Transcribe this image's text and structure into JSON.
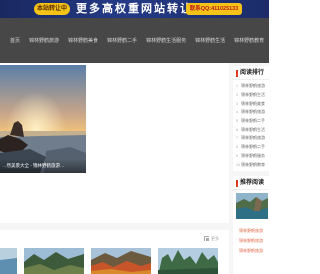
{
  "banner": {
    "badge": "本站转让中",
    "title": "更多高权重网站转让",
    "contact": "联系QQ:411025133"
  },
  "nav": {
    "items": [
      "首页",
      "锦林野鹤旅游",
      "锦林野鹤美食",
      "锦林野鹤二手",
      "锦林野鹤生活服务",
      "锦林野鹤生活",
      "锦林野鹤教育"
    ]
  },
  "hero": {
    "caption": "…然美景大全 - 锦林野鹤旅游…"
  },
  "sidebar": {
    "rank_title": "阅读排行",
    "rank_items": [
      {
        "num": "1",
        "text": "锦林野鹤旅游"
      },
      {
        "num": "2",
        "text": "锦林野鹤生活"
      },
      {
        "num": "3",
        "text": "锦林野鹤美食"
      },
      {
        "num": "4",
        "text": "锦林野鹤旅游"
      },
      {
        "num": "5",
        "text": "锦林野鹤二手"
      },
      {
        "num": "6",
        "text": "锦林野鹤生活"
      },
      {
        "num": "7",
        "text": "锦林野鹤旅游"
      },
      {
        "num": "8",
        "text": "锦林野鹤二手"
      },
      {
        "num": "9",
        "text": "锦林野鹤服务"
      },
      {
        "num": "10",
        "text": "锦林野鹤教育"
      }
    ],
    "rec_title": "推荐阅读",
    "rec_items": [
      "锦林野鹤旅游",
      "锦林野鹤旅游",
      "锦林野鹤旅游"
    ]
  },
  "strip": {
    "more": "更多"
  },
  "colors": {
    "banner": "#1a2860",
    "banner_badge": "#f3c318",
    "nav": "#474747",
    "accent": "#e03a1e",
    "rec_link": "#e06848"
  }
}
